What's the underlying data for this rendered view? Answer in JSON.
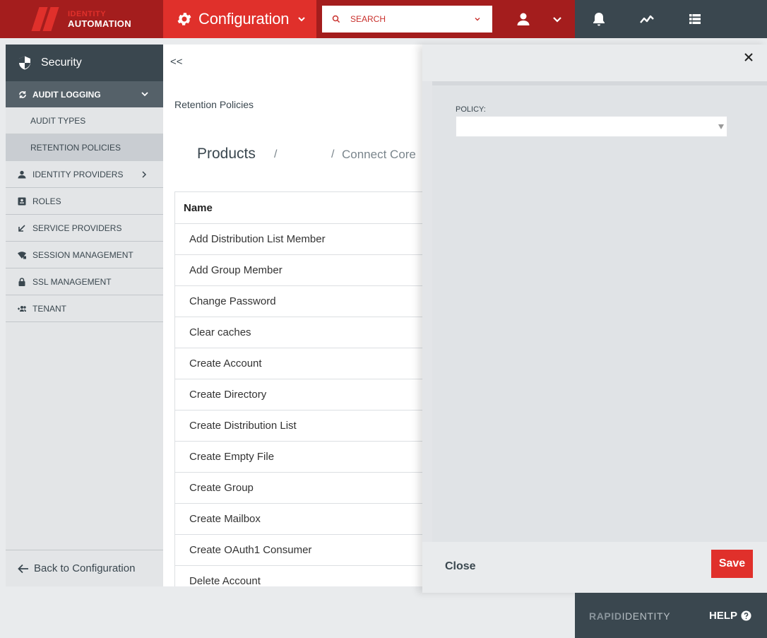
{
  "header": {
    "logo_line1": "IDENTITY",
    "logo_line2": "AUTOMATION",
    "module_title": "Configuration",
    "search_placeholder": "SEARCH"
  },
  "sidebar": {
    "section_title": "Security",
    "group_label": "AUDIT LOGGING",
    "sub_items": [
      {
        "label": "AUDIT TYPES"
      },
      {
        "label": "RETENTION POLICIES"
      }
    ],
    "items": [
      {
        "label": "IDENTITY PROVIDERS",
        "icon": "person-icon"
      },
      {
        "label": "ROLES",
        "icon": "id-card-icon"
      },
      {
        "label": "SERVICE PROVIDERS",
        "icon": "arrow-in-icon"
      },
      {
        "label": "SESSION MANAGEMENT",
        "icon": "wifi-lock-icon"
      },
      {
        "label": "SSL MANAGEMENT",
        "icon": "lock-icon"
      },
      {
        "label": "TENANT",
        "icon": "group-add-icon"
      }
    ],
    "back_label": "Back to Configuration"
  },
  "main": {
    "collapse_label": "<<",
    "page_title": "Retention Policies",
    "breadcrumb": {
      "first": "Products",
      "sep": "/",
      "last": "Connect Core"
    },
    "table": {
      "header": "Name",
      "rows": [
        "Add Distribution List Member",
        "Add Group Member",
        "Change Password",
        "Clear caches",
        "Create Account",
        "Create Directory",
        "Create Distribution List",
        "Create Empty File",
        "Create Group",
        "Create Mailbox",
        "Create OAuth1 Consumer",
        "Delete Account"
      ]
    }
  },
  "panel": {
    "policy_label": "POLICY:",
    "policy_value": "",
    "close_label": "Close",
    "save_label": "Save"
  },
  "footer": {
    "brand_part1": "RAPID",
    "brand_part2": "IDENTITY",
    "help_label": "HELP"
  },
  "colors": {
    "brand_red": "#e0302b",
    "dark_red": "#a41d1d",
    "slate": "#3a474f"
  }
}
